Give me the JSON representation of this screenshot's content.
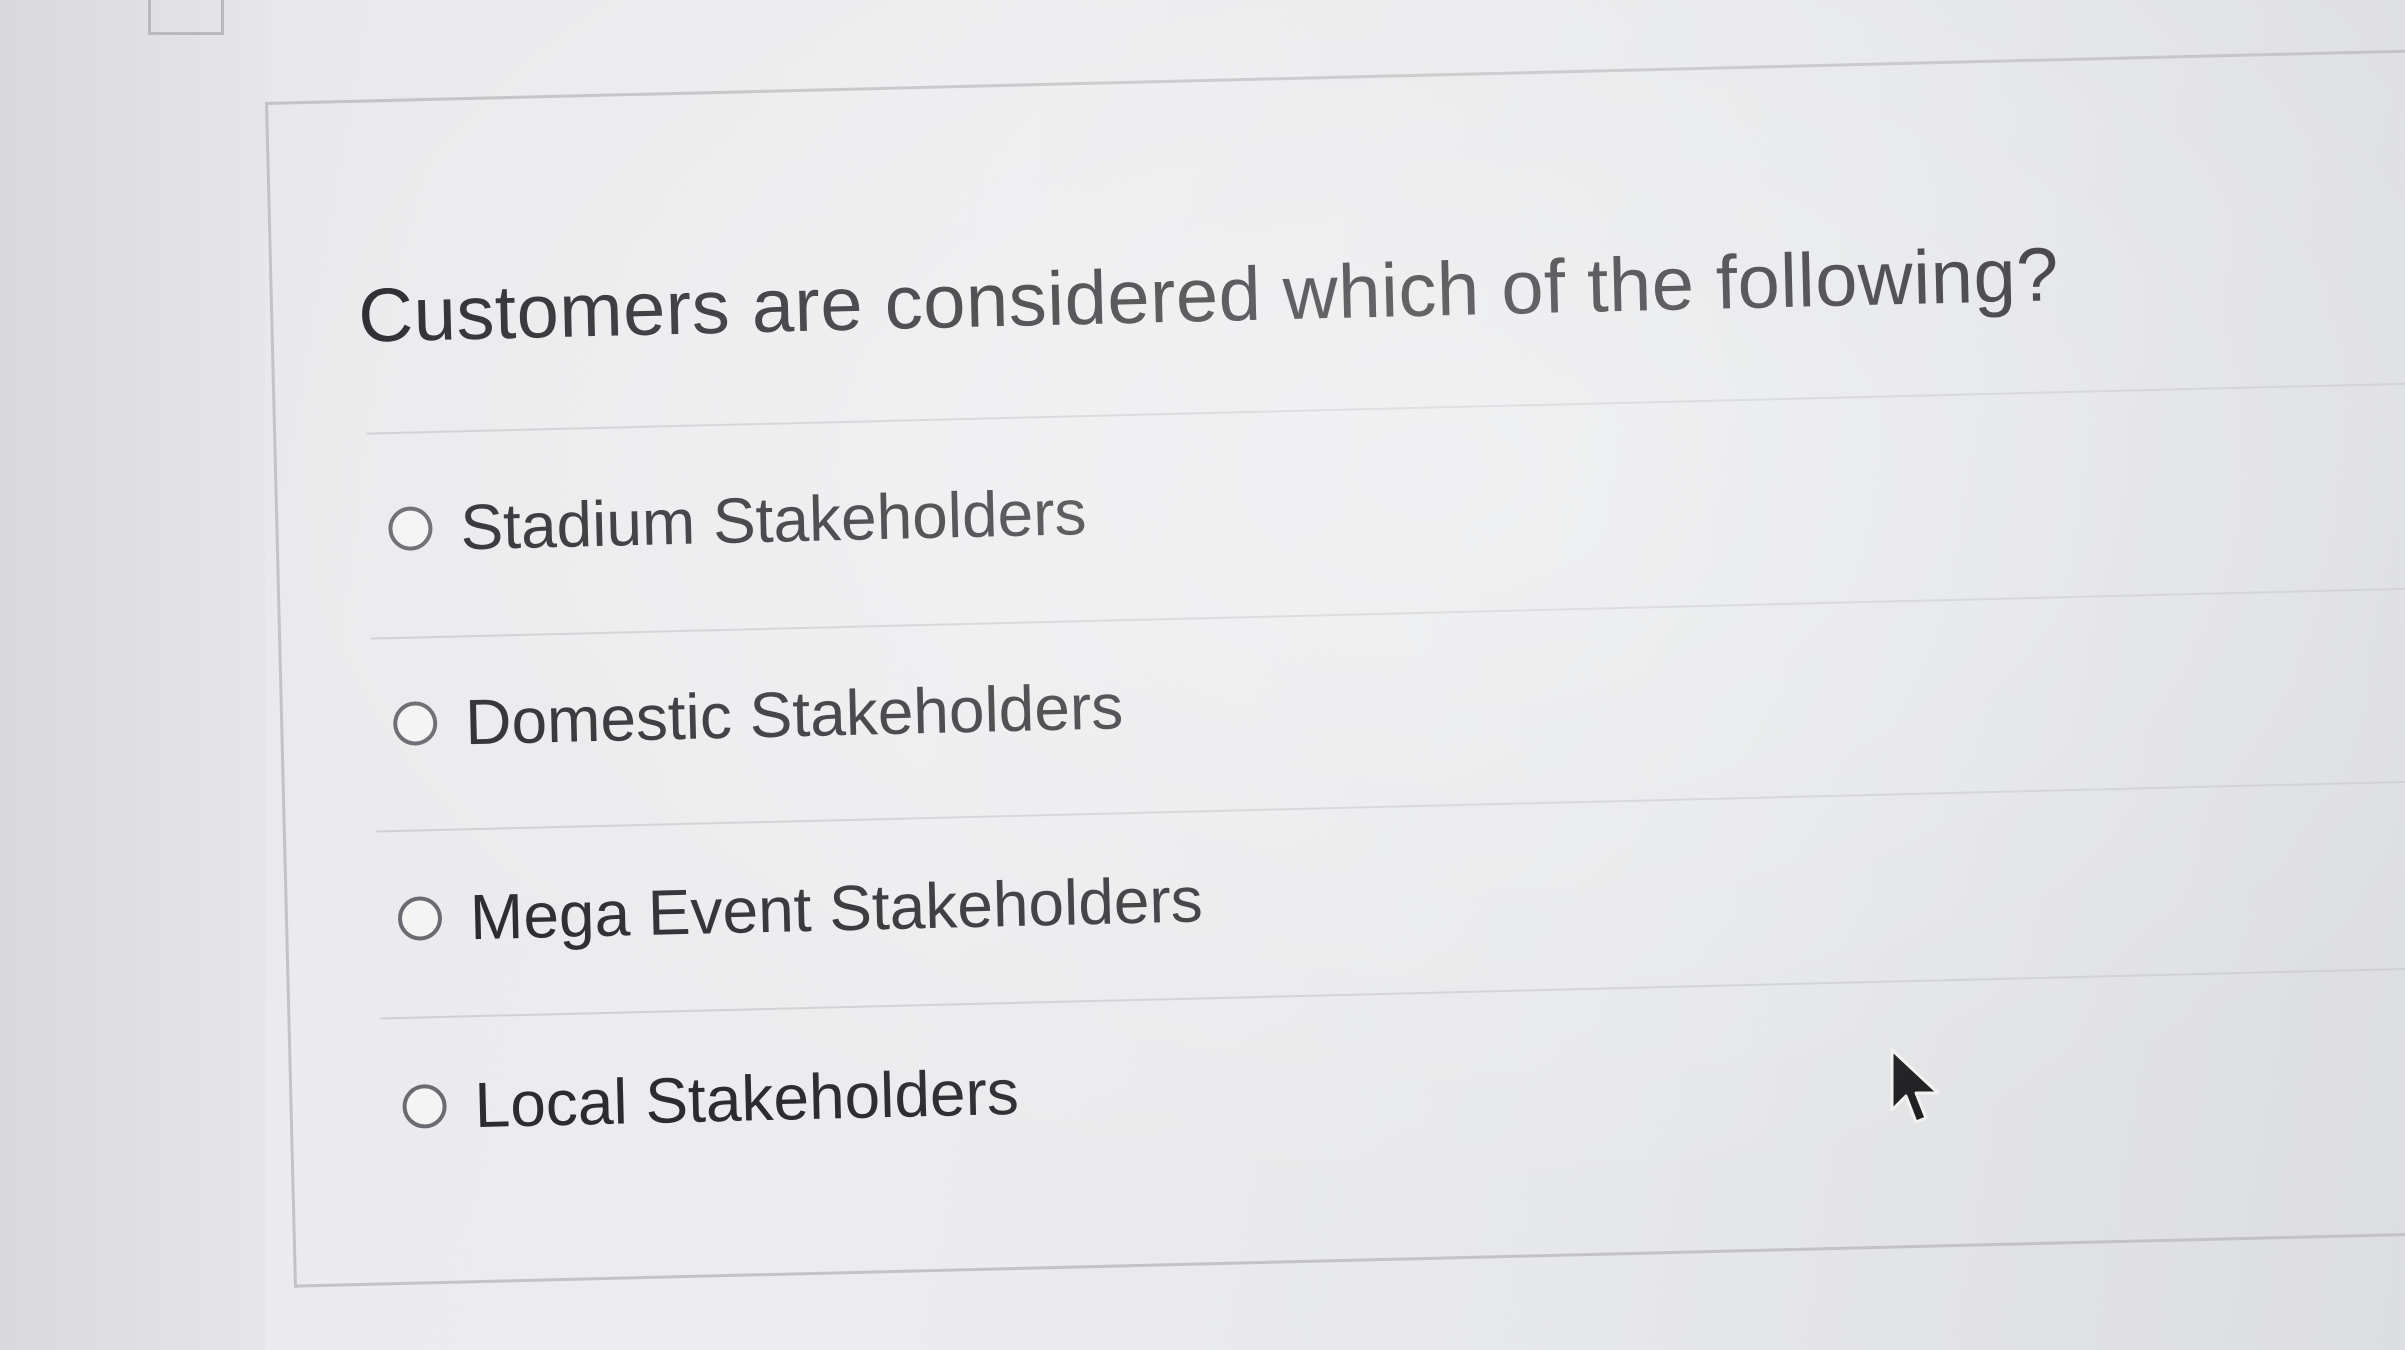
{
  "question": {
    "prompt": "Customers are considered which of the following?"
  },
  "options": [
    {
      "label": "Stadium Stakeholders",
      "selected": false
    },
    {
      "label": "Domestic Stakeholders",
      "selected": false
    },
    {
      "label": "Mega Event Stakeholders",
      "selected": false
    },
    {
      "label": "Local Stakeholders",
      "selected": false
    }
  ],
  "colors": {
    "background": "#ebebed",
    "text": "#2a2a2e",
    "radio_border": "#6a6a70",
    "divider": "#cfd0d3"
  },
  "icons": {
    "pointer": "mouse-pointer-icon"
  }
}
